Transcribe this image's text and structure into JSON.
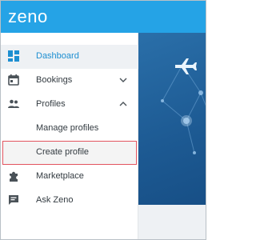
{
  "app": {
    "logo": "zeno"
  },
  "sidebar": {
    "items": [
      {
        "label": "Dashboard",
        "icon": "dashboard-icon",
        "state": "active"
      },
      {
        "label": "Bookings",
        "icon": "calendar-icon",
        "chevron": "chevron-down-icon"
      },
      {
        "label": "Profiles",
        "icon": "people-icon",
        "chevron": "chevron-up-icon"
      },
      {
        "label": "Manage profiles",
        "sub": true
      },
      {
        "label": "Create profile",
        "sub": true,
        "state": "selected"
      },
      {
        "label": "Marketplace",
        "icon": "puzzle-icon"
      },
      {
        "label": "Ask Zeno",
        "icon": "chat-icon"
      }
    ]
  },
  "colors": {
    "brand": "#25a3e6",
    "active_text": "#1e8fd1",
    "highlight_border": "#e2545f",
    "hero": "#1d5a93"
  }
}
